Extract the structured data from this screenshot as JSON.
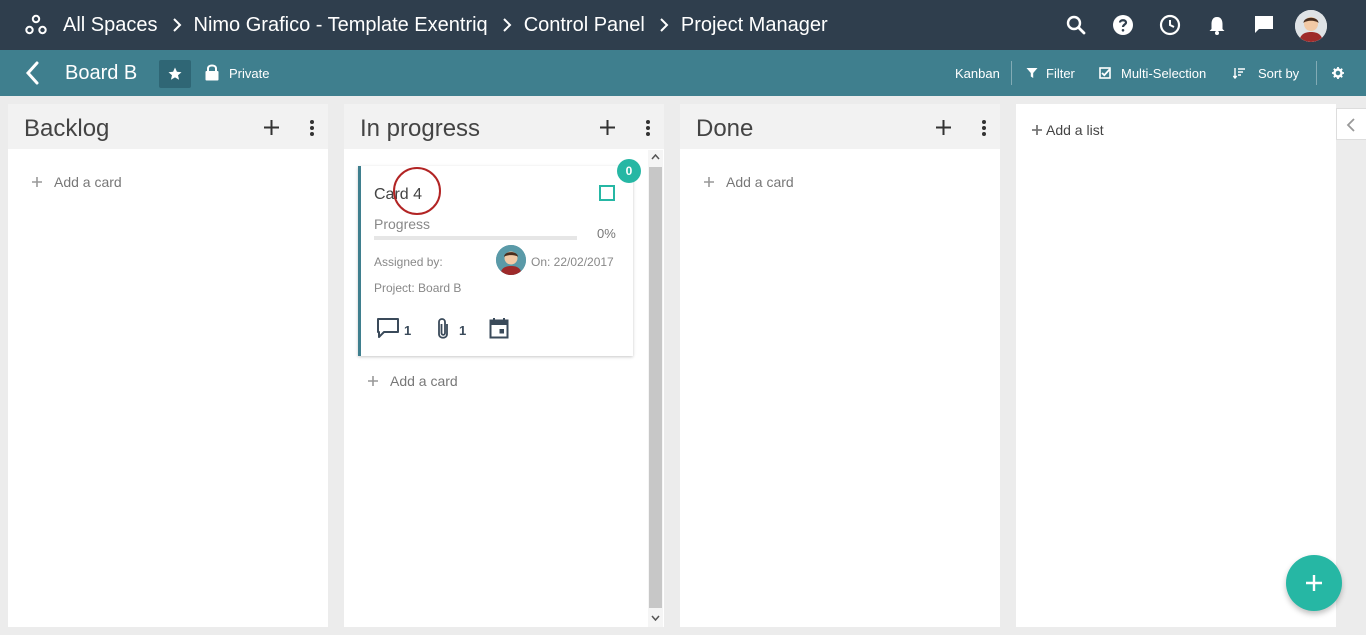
{
  "breadcrumb": {
    "items": [
      "All Spaces",
      "Nimo Grafico - Template Exentriq",
      "Control Panel",
      "Project Manager"
    ]
  },
  "topbar_icons": [
    "spaces-icon",
    "search-icon",
    "help-icon",
    "clock-icon",
    "bell-icon",
    "chat-icon",
    "user-avatar"
  ],
  "board": {
    "title": "Board B",
    "privacy": "Private",
    "view": "Kanban",
    "filter_label": "Filter",
    "multi_selection_label": "Multi-Selection",
    "sort_label": "Sort by"
  },
  "columns": [
    {
      "title": "Backlog",
      "add_card": "Add a card"
    },
    {
      "title": "In progress",
      "add_card": "Add a card"
    },
    {
      "title": "Done",
      "add_card": "Add a card"
    }
  ],
  "card": {
    "title": "Card 4",
    "badge": "0",
    "progress_label": "Progress",
    "progress_value": 0,
    "progress_text": "0%",
    "assigned_label": "Assigned by:",
    "date": "On: 22/02/2017",
    "project": "Project: Board B",
    "comments": "1",
    "attachments": "1"
  },
  "add_list": "Add a list",
  "colors": {
    "topbar": "#2f3e4d",
    "boardbar": "#3f7f8e",
    "accent": "#26b7a4",
    "focus_ring": "#b22424"
  }
}
